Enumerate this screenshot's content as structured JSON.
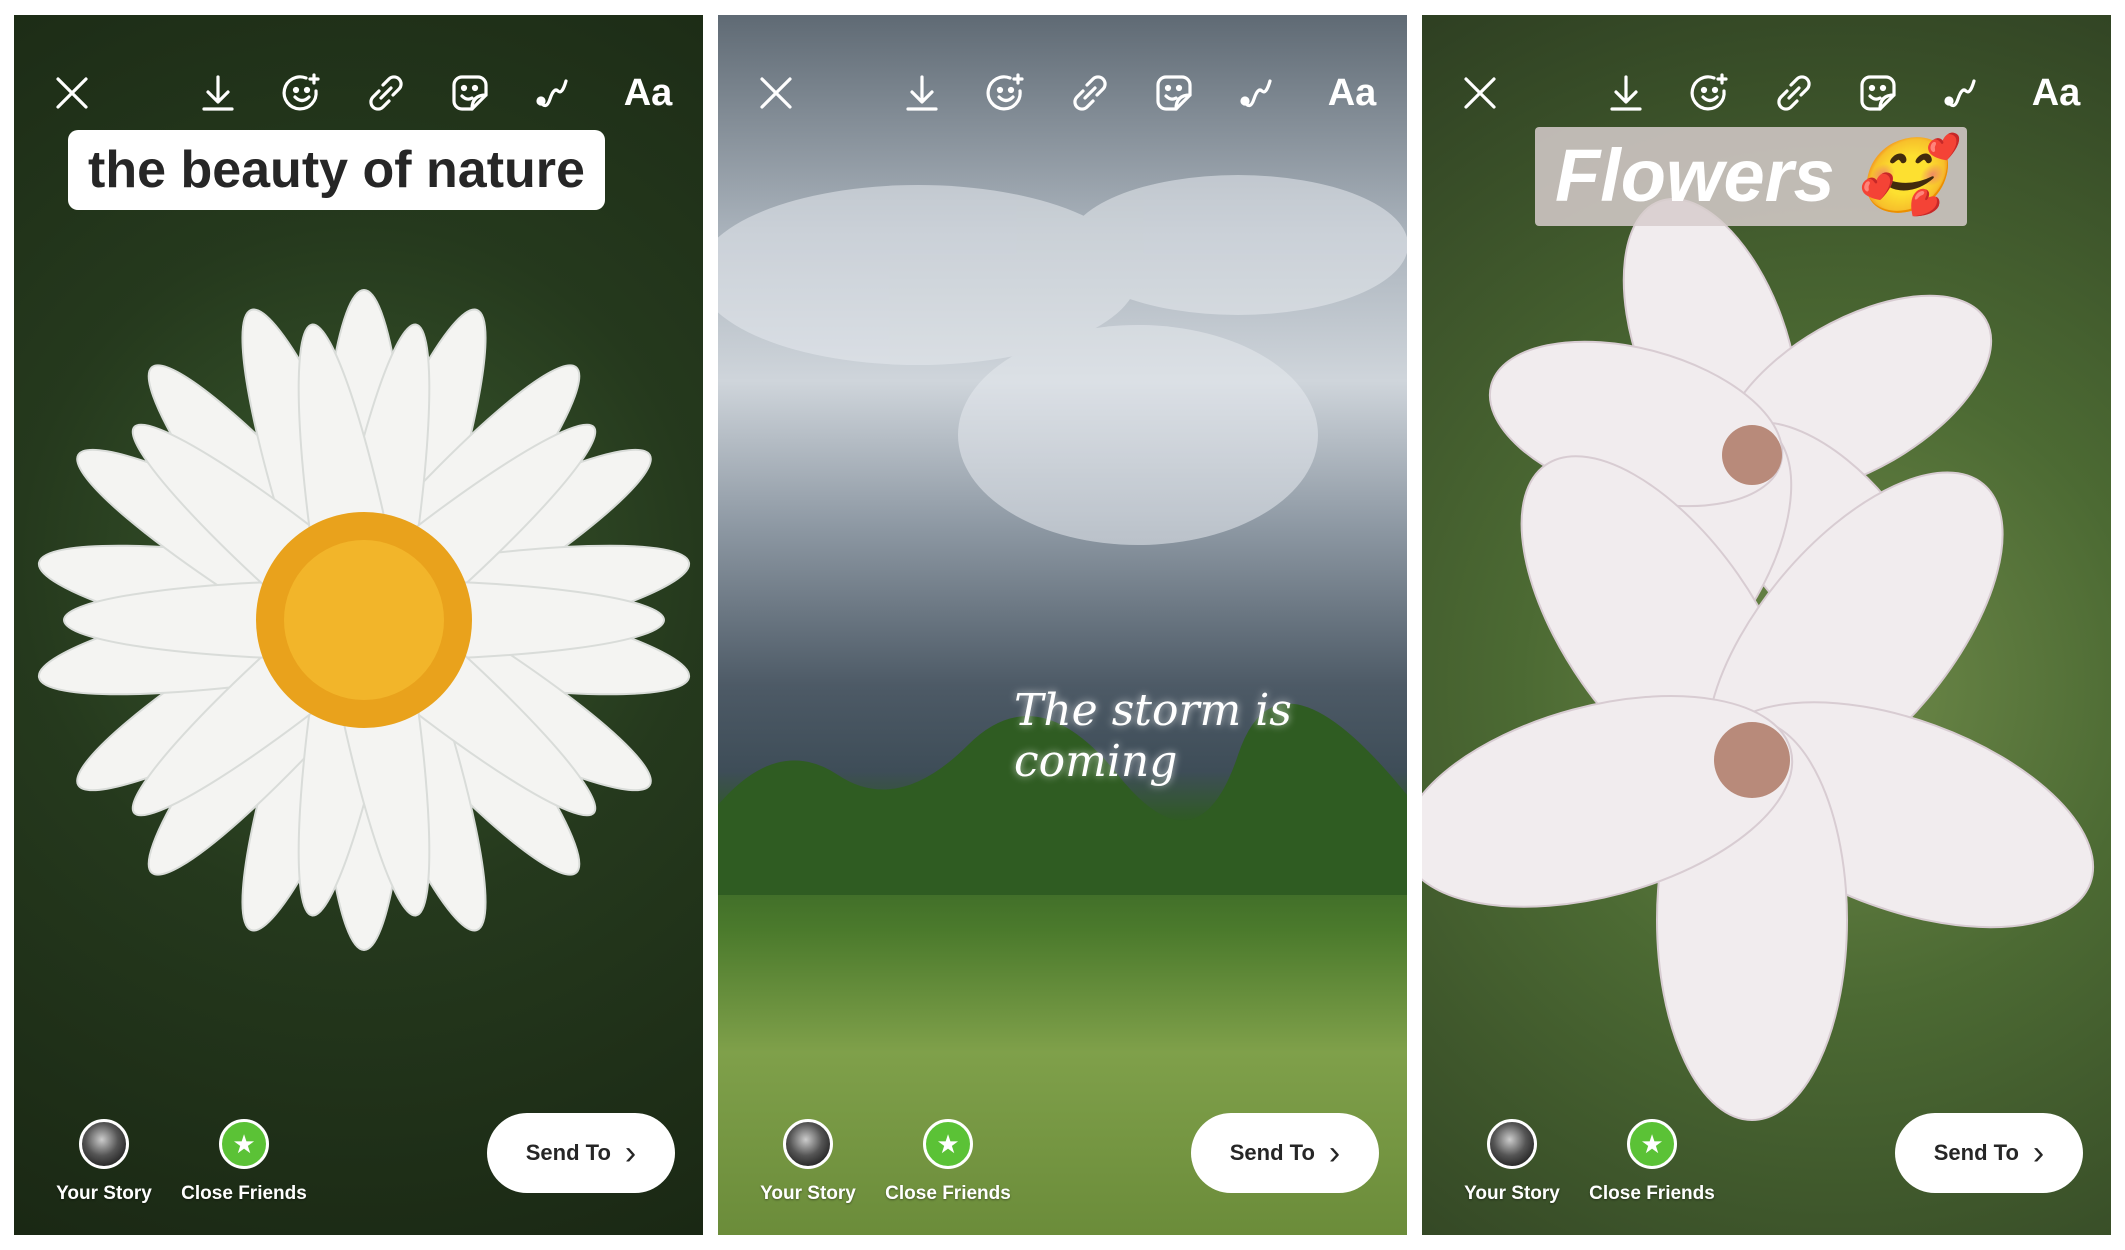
{
  "toolbar": {
    "close": "close-icon",
    "download": "download-icon",
    "effects": "face-effects-icon",
    "link": "link-icon",
    "sticker": "sticker-icon",
    "draw": "draw-icon",
    "text_label": "Aa"
  },
  "panels": [
    {
      "caption": "the beauty of nature",
      "photo": "white daisy"
    },
    {
      "caption": "The storm is coming",
      "photo": "storm clouds over field"
    },
    {
      "caption": "Flowers",
      "caption_emoji": "🥰",
      "photo": "pink apple blossoms"
    }
  ],
  "bottom": {
    "your_story": "Your Story",
    "close_friends": "Close Friends",
    "send_to": "Send To",
    "chevron": "›"
  },
  "colors": {
    "close_friends_green": "#5bc236",
    "caption_bg": "#ffffff",
    "caption_text": "#262626"
  }
}
